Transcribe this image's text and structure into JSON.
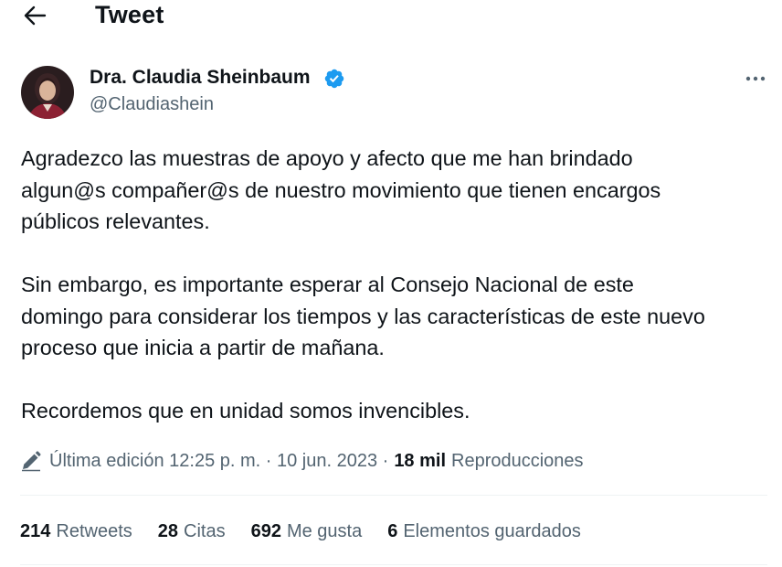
{
  "header": {
    "back_icon": "arrow-left-icon",
    "title": "Tweet"
  },
  "author": {
    "name": "Dra. Claudia Sheinbaum",
    "handle": "@Claudiashein",
    "verified_icon": "verified-badge-icon",
    "verified_color": "#1d9bf0"
  },
  "more_icon": "more-horizontal-icon",
  "tweet": {
    "lines": [
      "Agradezco las muestras de apoyo y afecto que me han brindado",
      "algun@s compañer@s de nuestro movimiento que tienen encargos",
      "públicos relevantes.",
      "",
      "Sin embargo, es importante esperar al Consejo Nacional de este",
      "domingo para considerar los tiempos y las características de este nuevo",
      "proceso que inicia a partir de mañana.",
      "",
      "Recordemos que en unidad somos invencibles."
    ]
  },
  "meta": {
    "edit_icon": "pencil-icon",
    "edited_label": "Última edición 12:25 p. m. · 10 jun. 2023 ·",
    "views_count": "18 mil",
    "views_label": "Reproducciones"
  },
  "stats": {
    "retweets": {
      "count": "214",
      "label": "Retweets"
    },
    "quotes": {
      "count": "28",
      "label": "Citas"
    },
    "likes": {
      "count": "692",
      "label": "Me gusta"
    },
    "bookmarks": {
      "count": "6",
      "label": "Elementos guardados"
    }
  },
  "colors": {
    "text_primary": "#0f1419",
    "text_secondary": "#536471",
    "accent": "#1d9bf0",
    "divider": "#eff3f4"
  }
}
